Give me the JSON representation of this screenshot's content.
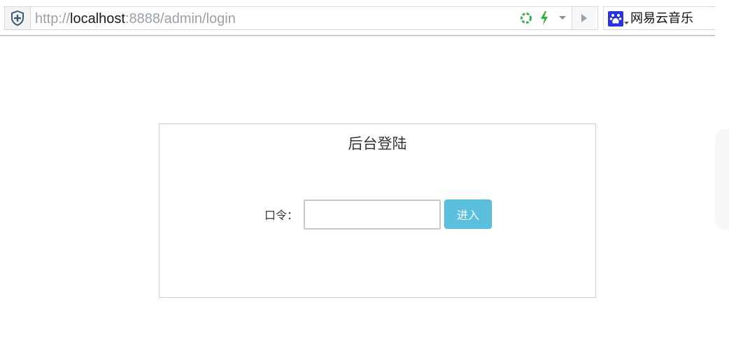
{
  "browser": {
    "url_scheme": "http://",
    "url_host": "localhost",
    "url_rest": ":8888/admin/login",
    "search_engine_icon": "baidu-paw-icon",
    "search_text": "网易云音乐",
    "icons": [
      "shield-icon",
      "refresh-icon",
      "lightning-icon",
      "dropdown-arrow-icon",
      "play-icon"
    ],
    "colors": {
      "accent_green": "#3cb34a",
      "shield": "#3d5a78"
    }
  },
  "login": {
    "title": "后台登陆",
    "password_label": "口令：",
    "password_value": "",
    "submit_label": "进入",
    "submit_color": "#5bc0de"
  }
}
